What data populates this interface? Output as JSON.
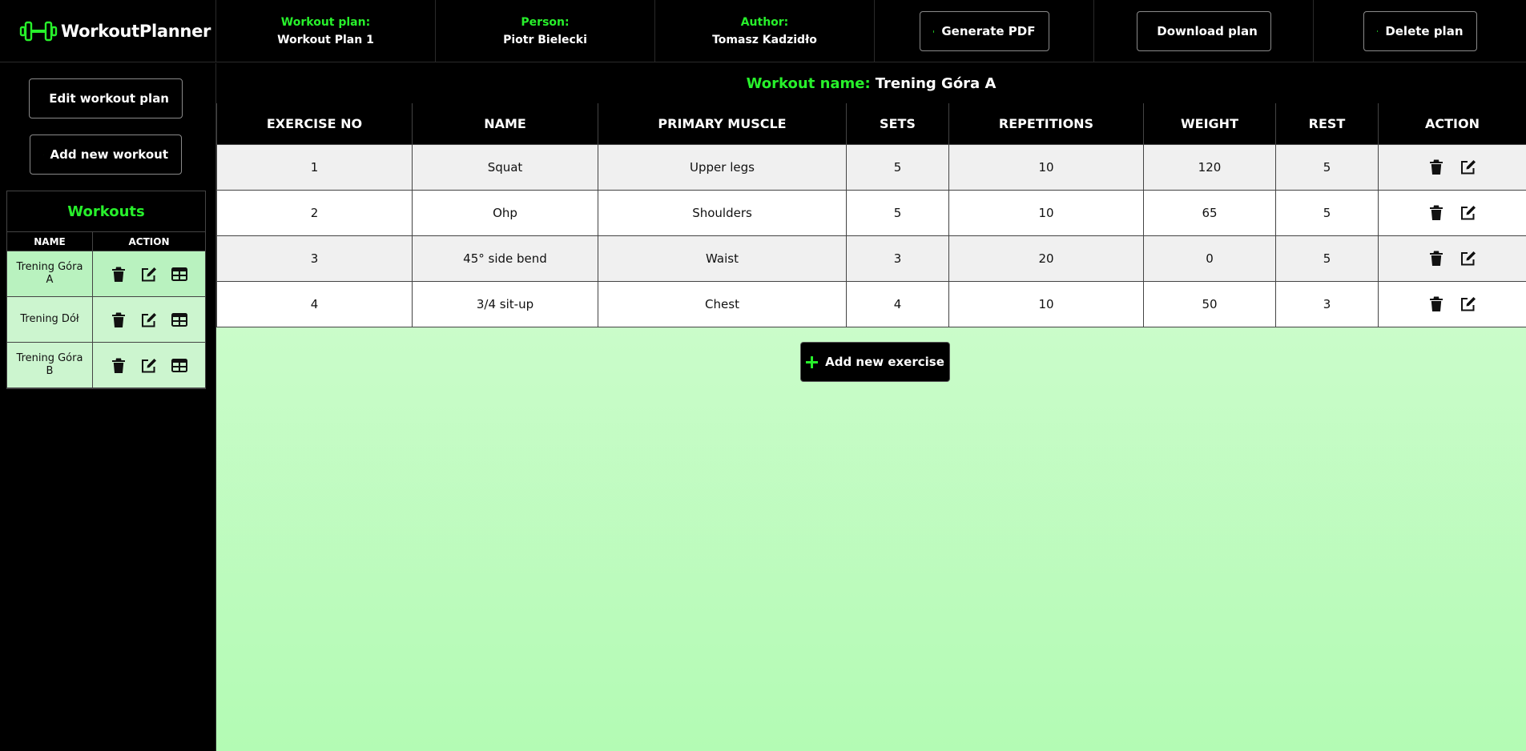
{
  "app": {
    "title": "WorkoutPlanner"
  },
  "header": {
    "plan": {
      "label": "Workout plan:",
      "value": "Workout Plan 1"
    },
    "person": {
      "label": "Person:",
      "value": "Piotr Bielecki"
    },
    "author": {
      "label": "Author:",
      "value": "Tomasz Kadzidło"
    },
    "generate_pdf": "Generate PDF",
    "download_plan": "Download plan",
    "delete_plan": "Delete plan"
  },
  "sidebar": {
    "edit_plan": "Edit workout plan",
    "add_workout": "Add new workout",
    "workouts_title": "Workouts",
    "columns": [
      "NAME",
      "ACTION"
    ],
    "workouts": [
      {
        "name": "Trening Góra A"
      },
      {
        "name": "Trening Dół"
      },
      {
        "name": "Trening Góra B"
      }
    ]
  },
  "main": {
    "workout_name_label": "Workout name:",
    "workout_name": "Trening Góra A",
    "columns": [
      "EXERCISE NO",
      "NAME",
      "PRIMARY MUSCLE",
      "SETS",
      "REPETITIONS",
      "WEIGHT",
      "REST",
      "ACTION"
    ],
    "exercises": [
      {
        "no": "1",
        "name": "Squat",
        "muscle": "Upper legs",
        "sets": "5",
        "reps": "10",
        "weight": "120",
        "rest": "5"
      },
      {
        "no": "2",
        "name": "Ohp",
        "muscle": "Shoulders",
        "sets": "5",
        "reps": "10",
        "weight": "65",
        "rest": "5"
      },
      {
        "no": "3",
        "name": "45° side bend",
        "muscle": "Waist",
        "sets": "3",
        "reps": "20",
        "weight": "0",
        "rest": "5"
      },
      {
        "no": "4",
        "name": "3/4 sit-up",
        "muscle": "Chest",
        "sets": "4",
        "reps": "10",
        "weight": "50",
        "rest": "3"
      }
    ],
    "add_exercise": "Add new exercise"
  },
  "colors": {
    "accent": "#27f02b",
    "background": "#000000",
    "table_bg_top": "#d8fcd7",
    "table_bg_bottom": "#b3fbb4"
  },
  "icons": [
    "dumbbell-icon",
    "file-pdf-icon",
    "file-download-icon",
    "trash-icon",
    "edit-icon",
    "plus-icon",
    "table-icon"
  ]
}
